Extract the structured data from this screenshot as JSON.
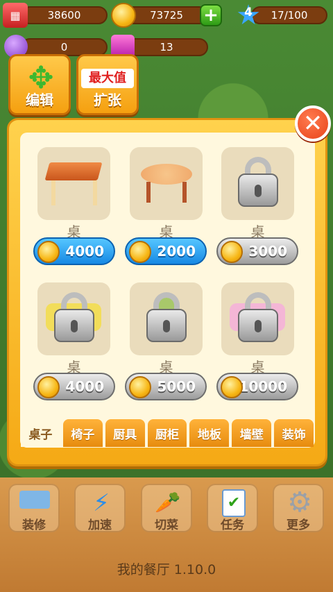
{
  "hud": {
    "cash": "38600",
    "coins": "73725",
    "level": "4",
    "xp": "17/100",
    "gems_purple": "0",
    "gems_pink": "13"
  },
  "top_buttons": {
    "edit_label": "编辑",
    "expand_label": "扩张",
    "max_badge": "最大值"
  },
  "shop": {
    "items": [
      {
        "name": "桌",
        "price": "4000",
        "locked": false
      },
      {
        "name": "桌",
        "price": "2000",
        "locked": false
      },
      {
        "name": "桌",
        "price": "3000",
        "locked": true
      },
      {
        "name": "桌",
        "price": "4000",
        "locked": true
      },
      {
        "name": "桌",
        "price": "5000",
        "locked": true
      },
      {
        "name": "桌",
        "price": "10000",
        "locked": true
      }
    ],
    "tabs": [
      "桌子",
      "椅子",
      "厨具",
      "厨柜",
      "地板",
      "墙壁",
      "装饰"
    ],
    "active_tab": "桌子"
  },
  "bottom_bar": {
    "items": [
      "装修",
      "加速",
      "切菜",
      "任务",
      "更多"
    ],
    "version": "我的餐厅 1.10.0"
  },
  "colors": {
    "accent": "#f5a915",
    "buy_blue": "#1789e4",
    "locked_gray": "#9c9c9c"
  }
}
